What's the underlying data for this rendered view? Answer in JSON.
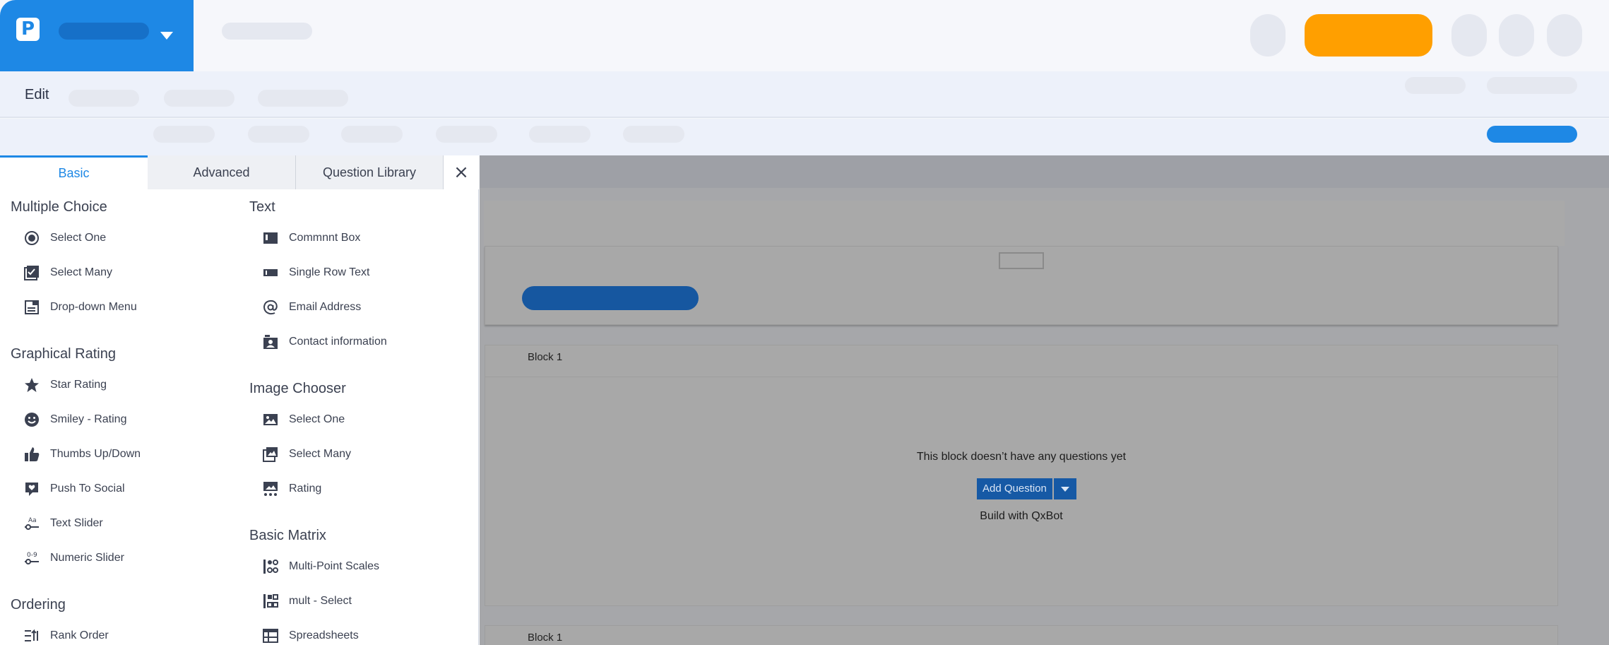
{
  "editbar": {
    "edit_label": "Edit"
  },
  "panel": {
    "tabs": [
      {
        "label": "Basic"
      },
      {
        "label": "Advanced"
      },
      {
        "label": "Question Library"
      }
    ],
    "close_glyph": "×",
    "sections": {
      "multiple_choice": {
        "title": "Multiple Choice",
        "items": [
          {
            "label": "Select One",
            "icon": "radio-icon"
          },
          {
            "label": "Select Many",
            "icon": "checkbox-icon"
          },
          {
            "label": "Drop-down Menu",
            "icon": "dropdown-menu-icon"
          }
        ]
      },
      "graphical_rating": {
        "title": "Graphical Rating",
        "items": [
          {
            "label": "Star Rating",
            "icon": "star-icon"
          },
          {
            "label": "Smiley - Rating",
            "icon": "smiley-icon"
          },
          {
            "label": "Thumbs Up/Down",
            "icon": "thumbs-up-icon"
          },
          {
            "label": "Push To Social",
            "icon": "heart-bubble-icon"
          },
          {
            "label": "Text Slider",
            "icon": "text-slider-icon"
          },
          {
            "label": "Numeric Slider",
            "icon": "numeric-slider-icon"
          }
        ]
      },
      "ordering": {
        "title": "Ordering",
        "items": [
          {
            "label": "Rank Order",
            "icon": "rank-order-icon"
          }
        ]
      },
      "text": {
        "title": "Text",
        "items": [
          {
            "label": "Commnnt Box",
            "icon": "comment-box-icon"
          },
          {
            "label": "Single Row Text",
            "icon": "single-row-text-icon"
          },
          {
            "label": "Email Address",
            "icon": "at-sign-icon"
          },
          {
            "label": "Contact information",
            "icon": "contact-card-icon"
          }
        ]
      },
      "image_chooser": {
        "title": "Image Chooser",
        "items": [
          {
            "label": "Select One",
            "icon": "image-icon"
          },
          {
            "label": "Select Many",
            "icon": "images-icon"
          },
          {
            "label": "Rating",
            "icon": "image-rating-icon"
          }
        ]
      },
      "basic_matrix": {
        "title": "Basic Matrix",
        "items": [
          {
            "label": "Multi-Point Scales",
            "icon": "multi-point-scale-icon"
          },
          {
            "label": "mult - Select",
            "icon": "matrix-select-icon"
          },
          {
            "label": "Spreadsheets",
            "icon": "spreadsheet-icon"
          }
        ]
      }
    }
  },
  "editor": {
    "blocks": [
      {
        "title": "Block 1",
        "empty_message": "This block doesn’t have any questions yet",
        "add_question_label": "Add Question",
        "build_label": "Build with QxBot"
      },
      {
        "title": "Block 1"
      }
    ]
  },
  "colors": {
    "brand": "#1e88e5",
    "accent_orange": "#ff9f00",
    "add_question_bg": "#1659a5"
  }
}
